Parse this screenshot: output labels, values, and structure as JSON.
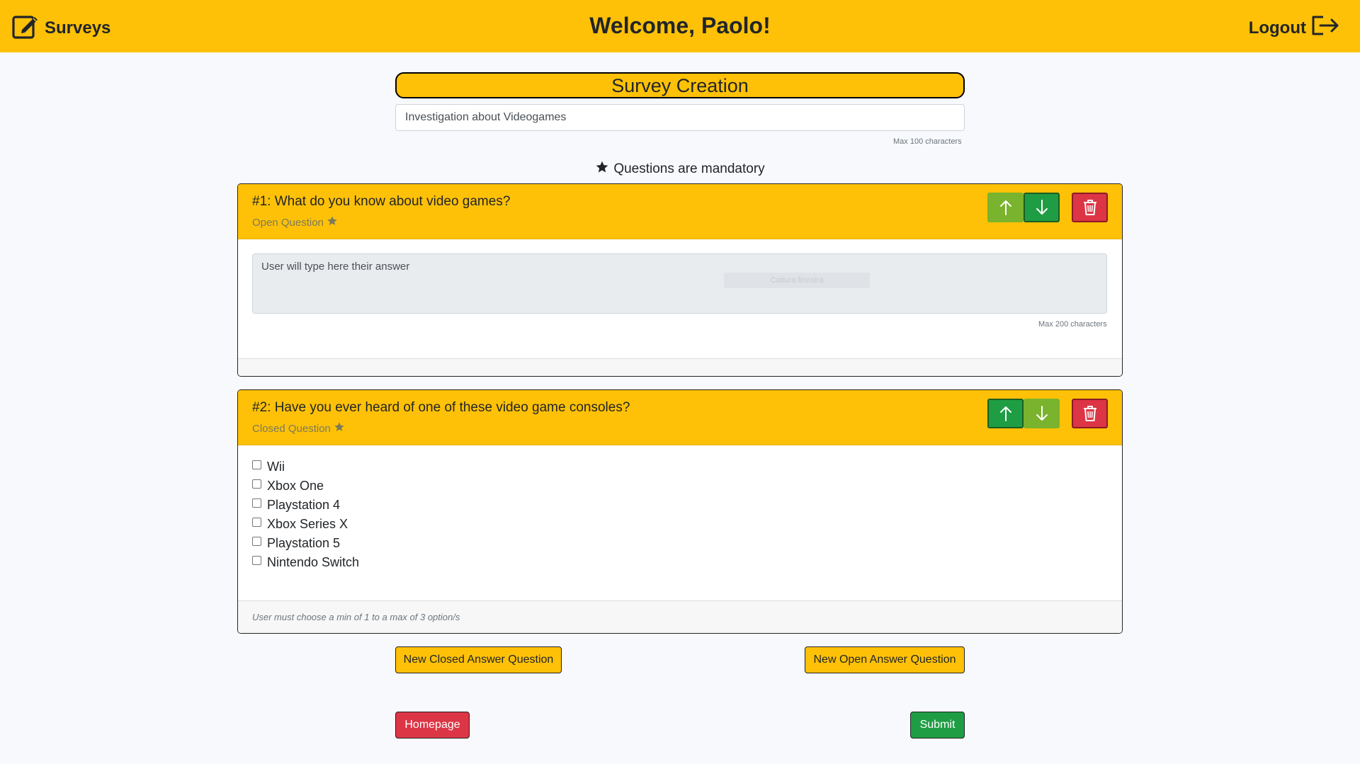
{
  "navbar": {
    "brand": "Surveys",
    "welcome": "Welcome, Paolo!",
    "logout": "Logout"
  },
  "creation": {
    "heading": "Survey Creation",
    "title_value": "Investigation about Videogames",
    "title_max": "Max 100 characters",
    "mandatory_note": "Questions are mandatory"
  },
  "questions": [
    {
      "title": "#1: What do you know about video games?",
      "type": "Open Question",
      "answer_placeholder": "User will type here their answer",
      "ghost_text": "Cattura finestra",
      "max_note": "Max 200 characters"
    },
    {
      "title": "#2: Have you ever heard of one of these video game consoles?",
      "type": "Closed Question",
      "options": [
        "Wii",
        "Xbox One",
        "Playstation 4",
        "Xbox Series X",
        "Playstation 5",
        "Nintendo Switch"
      ],
      "constraint": "User must choose a min of 1 to a max of 3 option/s"
    }
  ],
  "actions": {
    "new_closed": "New Closed Answer Question",
    "new_open": "New Open Answer Question",
    "homepage": "Homepage",
    "submit": "Submit"
  },
  "colors": {
    "primary": "#ffc107",
    "success": "#1f9d44",
    "danger": "#dc3545",
    "background": "#f8f9fc"
  }
}
